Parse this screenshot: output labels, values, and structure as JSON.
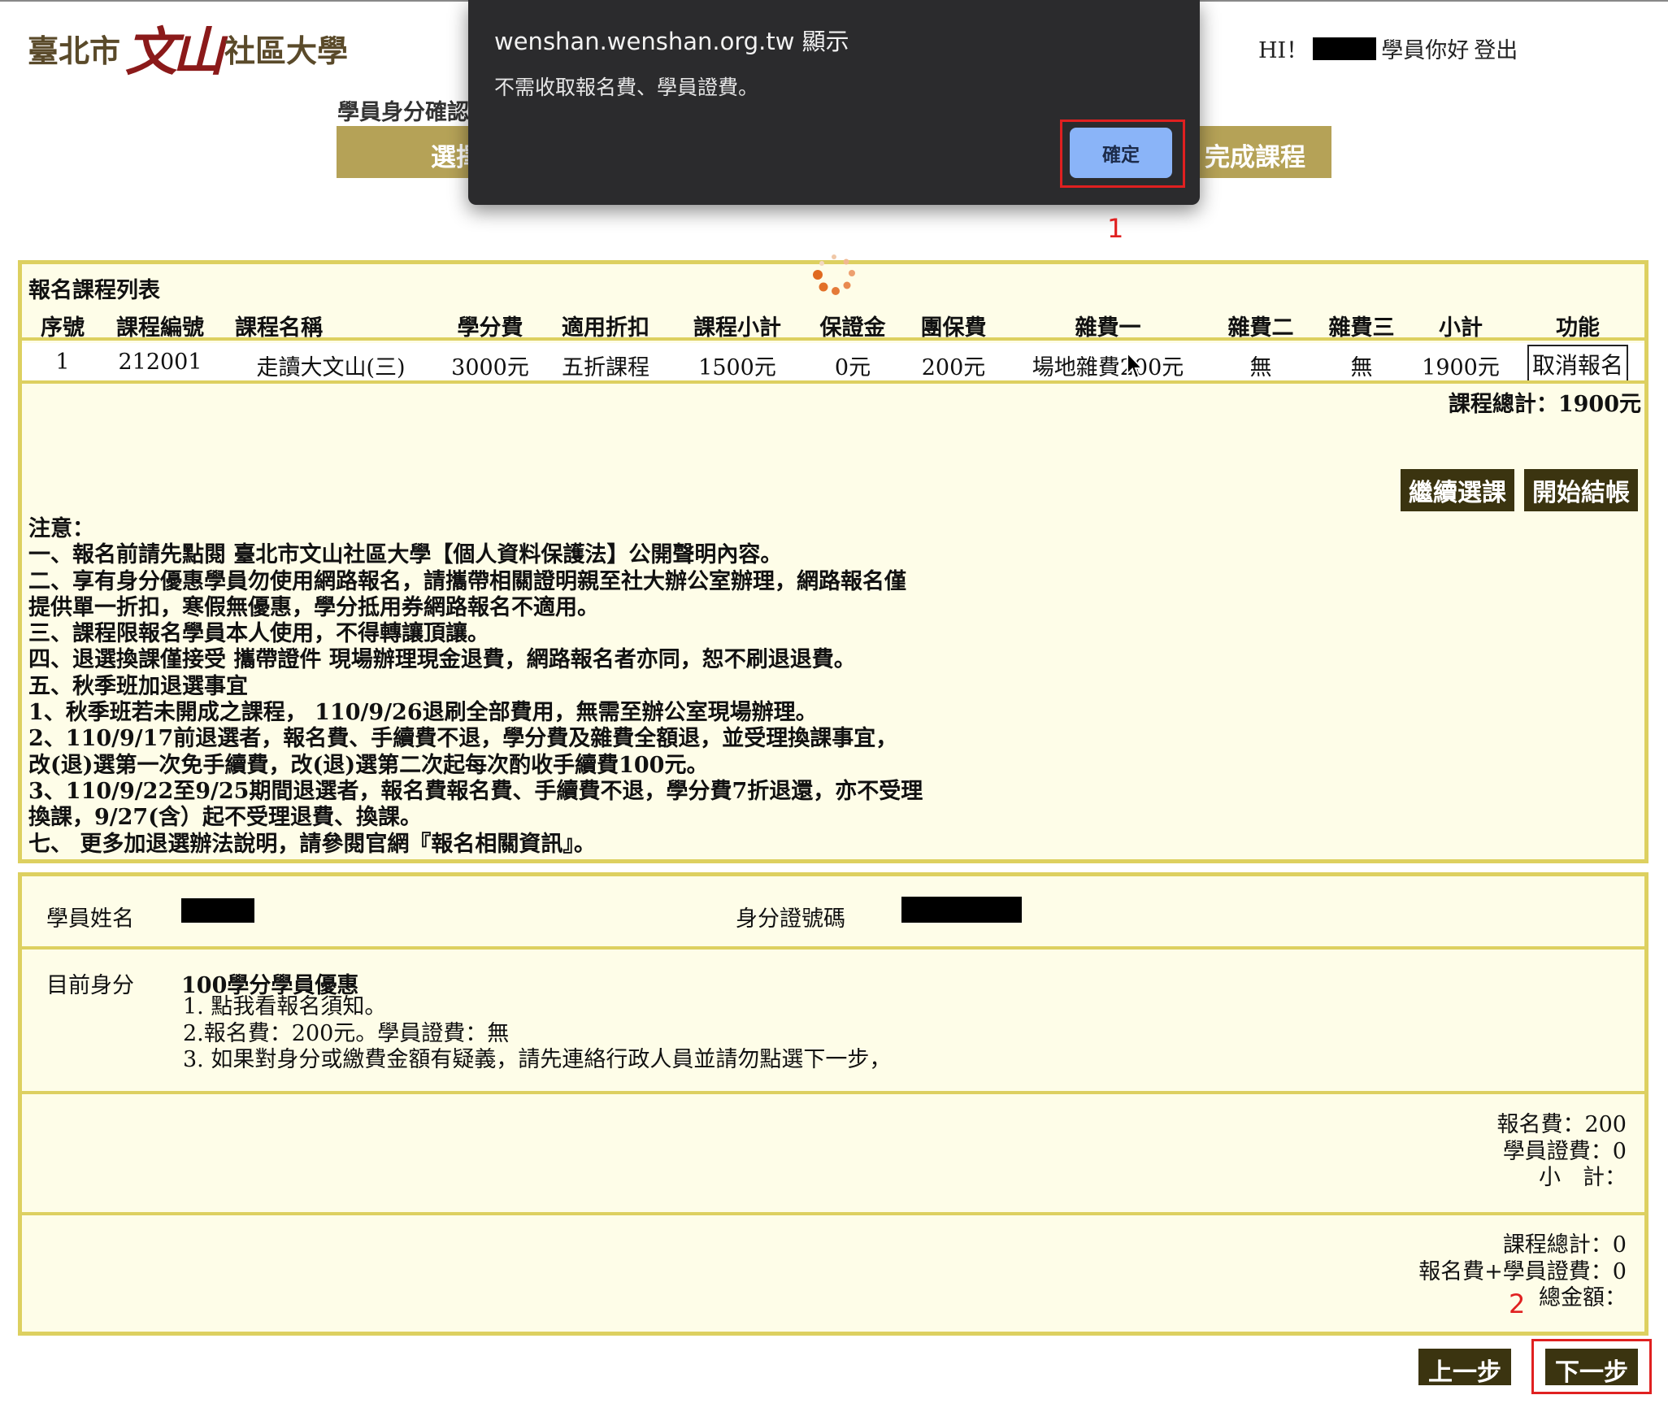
{
  "header": {
    "logo_left": "臺北市",
    "logo_brand": "文山",
    "logo_right": "社區大學",
    "greeting_prefix": "HI！",
    "greeting_suffix": "學員你好",
    "logout_label": "登出"
  },
  "breadcrumb": "學員身分確認",
  "steps": {
    "step1_label": "選擇",
    "step_last_label": "完成課程"
  },
  "dialog": {
    "title": "wenshan.wenshan.org.tw 顯示",
    "message": "不需收取報名費、學員證費。",
    "ok_label": "確定"
  },
  "annotations": {
    "marker1": "1",
    "marker2": "2"
  },
  "course_table": {
    "title": "報名課程列表",
    "headers": [
      "序號",
      "課程編號",
      "課程名稱",
      "學分費",
      "適用折扣",
      "課程小計",
      "保證金",
      "團保費",
      "雜費一",
      "雜費二",
      "雜費三",
      "小計",
      "功能"
    ],
    "rows": [
      {
        "no": "1",
        "code": "212001",
        "name": "走讀大文山(三)",
        "credit_fee": "3000元",
        "discount": "五折課程",
        "course_subtotal": "1500元",
        "deposit": "0元",
        "insurance": "200元",
        "misc1": "場地雜費200元",
        "misc2": "無",
        "misc3": "無",
        "subtotal": "1900元",
        "action": "取消報名"
      }
    ],
    "total": "課程總計：1900元",
    "continue_label": "繼續選課",
    "checkout_label": "開始結帳"
  },
  "notes": [
    "注意：",
    "一、報名前請先點閱 臺北市文山社區大學【個人資料保護法】公開聲明內容。",
    "二、享有身分優惠學員勿使用網路報名，請攜帶相關證明親至社大辦公室辦理，網路報名僅",
    "提供單一折扣，寒假無優惠，學分抵用券網路報名不適用。",
    "三、課程限報名學員本人使用，不得轉讓頂讓。",
    "四、退選換課僅接受 攜帶證件 現場辦理現金退費，網路報名者亦同，恕不刷退退費。",
    "五、秋季班加退選事宜",
    "1、秋季班若未開成之課程， 110/9/26退刷全部費用，無需至辦公室現場辦理。",
    "2、110/9/17前退選者，報名費、手續費不退，學分費及雜費全額退，並受理換課事宜，",
    "改(退)選第一次免手續費，改(退)選第二次起每次酌收手續費100元。",
    "3、110/9/22至9/25期間退選者，報名費報名費、手續費不退，學分費7折退還，亦不受理",
    "換課，9/27(含）起不受理退費、換課。",
    "七、 更多加退選辦法說明，請參閱官網『報名相關資訊』。"
  ],
  "student": {
    "name_label": "學員姓名",
    "id_label": "身分證號碼",
    "identity_label": "目前身分",
    "identity_title": "100學分學員優惠",
    "identity_lines": [
      "1. 點我看報名須知。",
      "2.報名費：200元。學員證費：無",
      "3. 如果對身分或繳費金額有疑義，請先連絡行政人員並請勿點選下一步，"
    ]
  },
  "fees": {
    "registration": "報名費：200",
    "student_card": "學員證費：0",
    "subtotal": "小　計："
  },
  "summary": {
    "course_total": "課程總計：0",
    "reg_plus_card": "報名費+學員證費：0",
    "grand_total": "總金額："
  },
  "nav": {
    "prev_label": "上一步",
    "next_label": "下一步"
  },
  "colors": {
    "panel_bg": "#fefde8",
    "panel_border": "#ddd060",
    "step_bar": "#b5a257",
    "dark_button": "#3b3410",
    "dialog_bg": "#2b2b2d",
    "ok_button": "#8ab4f8",
    "annotation_red": "#e02020"
  }
}
